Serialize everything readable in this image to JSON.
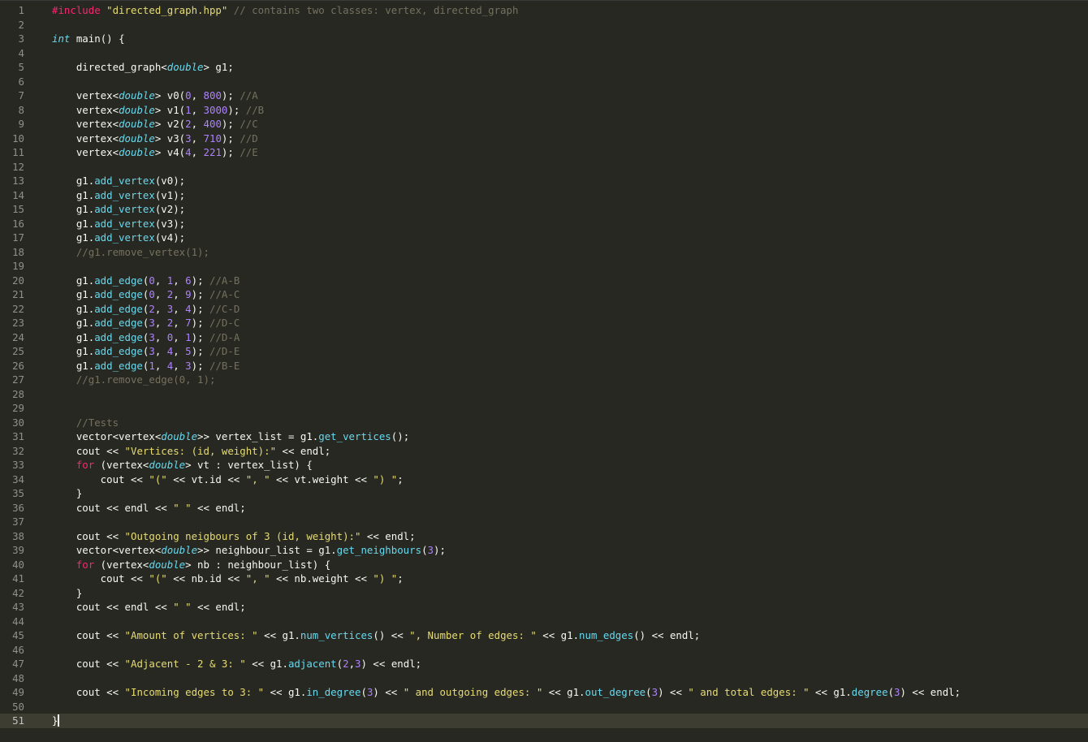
{
  "colors": {
    "background": "#272822",
    "plain": "#f8f8f2",
    "keyword": "#f92672",
    "type": "#66d9ef",
    "string": "#e6db74",
    "number": "#ae81ff",
    "comment": "#75715e",
    "function": "#66d9ef",
    "line_number": "#8f908a"
  },
  "current_line": 51,
  "lines": [
    {
      "n": "1",
      "tokens": [
        [
          "pre",
          "#include "
        ],
        [
          "str",
          "\"directed_graph.hpp\""
        ],
        [
          "cmt",
          " // contains two classes: vertex, directed_graph"
        ]
      ]
    },
    {
      "n": "2",
      "tokens": []
    },
    {
      "n": "3",
      "tokens": [
        [
          "type",
          "int"
        ],
        [
          "plain",
          " main() {"
        ]
      ]
    },
    {
      "n": "4",
      "tokens": []
    },
    {
      "n": "5",
      "tokens": [
        [
          "plain",
          "    directed_graph<"
        ],
        [
          "type",
          "double"
        ],
        [
          "plain",
          "> g1;"
        ]
      ]
    },
    {
      "n": "6",
      "tokens": []
    },
    {
      "n": "7",
      "tokens": [
        [
          "plain",
          "    vertex<"
        ],
        [
          "type",
          "double"
        ],
        [
          "plain",
          "> v0("
        ],
        [
          "num",
          "0"
        ],
        [
          "plain",
          ", "
        ],
        [
          "num",
          "800"
        ],
        [
          "plain",
          "); "
        ],
        [
          "cmt",
          "//A"
        ]
      ]
    },
    {
      "n": "8",
      "tokens": [
        [
          "plain",
          "    vertex<"
        ],
        [
          "type",
          "double"
        ],
        [
          "plain",
          "> v1("
        ],
        [
          "num",
          "1"
        ],
        [
          "plain",
          ", "
        ],
        [
          "num",
          "3000"
        ],
        [
          "plain",
          "); "
        ],
        [
          "cmt",
          "//B"
        ]
      ]
    },
    {
      "n": "9",
      "tokens": [
        [
          "plain",
          "    vertex<"
        ],
        [
          "type",
          "double"
        ],
        [
          "plain",
          "> v2("
        ],
        [
          "num",
          "2"
        ],
        [
          "plain",
          ", "
        ],
        [
          "num",
          "400"
        ],
        [
          "plain",
          "); "
        ],
        [
          "cmt",
          "//C"
        ]
      ]
    },
    {
      "n": "10",
      "tokens": [
        [
          "plain",
          "    vertex<"
        ],
        [
          "type",
          "double"
        ],
        [
          "plain",
          "> v3("
        ],
        [
          "num",
          "3"
        ],
        [
          "plain",
          ", "
        ],
        [
          "num",
          "710"
        ],
        [
          "plain",
          "); "
        ],
        [
          "cmt",
          "//D"
        ]
      ]
    },
    {
      "n": "11",
      "tokens": [
        [
          "plain",
          "    vertex<"
        ],
        [
          "type",
          "double"
        ],
        [
          "plain",
          "> v4("
        ],
        [
          "num",
          "4"
        ],
        [
          "plain",
          ", "
        ],
        [
          "num",
          "221"
        ],
        [
          "plain",
          "); "
        ],
        [
          "cmt",
          "//E"
        ]
      ]
    },
    {
      "n": "12",
      "tokens": []
    },
    {
      "n": "13",
      "tokens": [
        [
          "plain",
          "    g1."
        ],
        [
          "fn",
          "add_vertex"
        ],
        [
          "plain",
          "(v0);"
        ]
      ]
    },
    {
      "n": "14",
      "tokens": [
        [
          "plain",
          "    g1."
        ],
        [
          "fn",
          "add_vertex"
        ],
        [
          "plain",
          "(v1);"
        ]
      ]
    },
    {
      "n": "15",
      "tokens": [
        [
          "plain",
          "    g1."
        ],
        [
          "fn",
          "add_vertex"
        ],
        [
          "plain",
          "(v2);"
        ]
      ]
    },
    {
      "n": "16",
      "tokens": [
        [
          "plain",
          "    g1."
        ],
        [
          "fn",
          "add_vertex"
        ],
        [
          "plain",
          "(v3);"
        ]
      ]
    },
    {
      "n": "17",
      "tokens": [
        [
          "plain",
          "    g1."
        ],
        [
          "fn",
          "add_vertex"
        ],
        [
          "plain",
          "(v4);"
        ]
      ]
    },
    {
      "n": "18",
      "tokens": [
        [
          "cmt",
          "    //g1.remove_vertex(1);"
        ]
      ]
    },
    {
      "n": "19",
      "tokens": []
    },
    {
      "n": "20",
      "tokens": [
        [
          "plain",
          "    g1."
        ],
        [
          "fn",
          "add_edge"
        ],
        [
          "plain",
          "("
        ],
        [
          "num",
          "0"
        ],
        [
          "plain",
          ", "
        ],
        [
          "num",
          "1"
        ],
        [
          "plain",
          ", "
        ],
        [
          "num",
          "6"
        ],
        [
          "plain",
          "); "
        ],
        [
          "cmt",
          "//A-B"
        ]
      ]
    },
    {
      "n": "21",
      "tokens": [
        [
          "plain",
          "    g1."
        ],
        [
          "fn",
          "add_edge"
        ],
        [
          "plain",
          "("
        ],
        [
          "num",
          "0"
        ],
        [
          "plain",
          ", "
        ],
        [
          "num",
          "2"
        ],
        [
          "plain",
          ", "
        ],
        [
          "num",
          "9"
        ],
        [
          "plain",
          "); "
        ],
        [
          "cmt",
          "//A-C"
        ]
      ]
    },
    {
      "n": "22",
      "tokens": [
        [
          "plain",
          "    g1."
        ],
        [
          "fn",
          "add_edge"
        ],
        [
          "plain",
          "("
        ],
        [
          "num",
          "2"
        ],
        [
          "plain",
          ", "
        ],
        [
          "num",
          "3"
        ],
        [
          "plain",
          ", "
        ],
        [
          "num",
          "4"
        ],
        [
          "plain",
          "); "
        ],
        [
          "cmt",
          "//C-D"
        ]
      ]
    },
    {
      "n": "23",
      "tokens": [
        [
          "plain",
          "    g1."
        ],
        [
          "fn",
          "add_edge"
        ],
        [
          "plain",
          "("
        ],
        [
          "num",
          "3"
        ],
        [
          "plain",
          ", "
        ],
        [
          "num",
          "2"
        ],
        [
          "plain",
          ", "
        ],
        [
          "num",
          "7"
        ],
        [
          "plain",
          "); "
        ],
        [
          "cmt",
          "//D-C"
        ]
      ]
    },
    {
      "n": "24",
      "tokens": [
        [
          "plain",
          "    g1."
        ],
        [
          "fn",
          "add_edge"
        ],
        [
          "plain",
          "("
        ],
        [
          "num",
          "3"
        ],
        [
          "plain",
          ", "
        ],
        [
          "num",
          "0"
        ],
        [
          "plain",
          ", "
        ],
        [
          "num",
          "1"
        ],
        [
          "plain",
          "); "
        ],
        [
          "cmt",
          "//D-A"
        ]
      ]
    },
    {
      "n": "25",
      "tokens": [
        [
          "plain",
          "    g1."
        ],
        [
          "fn",
          "add_edge"
        ],
        [
          "plain",
          "("
        ],
        [
          "num",
          "3"
        ],
        [
          "plain",
          ", "
        ],
        [
          "num",
          "4"
        ],
        [
          "plain",
          ", "
        ],
        [
          "num",
          "5"
        ],
        [
          "plain",
          "); "
        ],
        [
          "cmt",
          "//D-E"
        ]
      ]
    },
    {
      "n": "26",
      "tokens": [
        [
          "plain",
          "    g1."
        ],
        [
          "fn",
          "add_edge"
        ],
        [
          "plain",
          "("
        ],
        [
          "num",
          "1"
        ],
        [
          "plain",
          ", "
        ],
        [
          "num",
          "4"
        ],
        [
          "plain",
          ", "
        ],
        [
          "num",
          "3"
        ],
        [
          "plain",
          "); "
        ],
        [
          "cmt",
          "//B-E"
        ]
      ]
    },
    {
      "n": "27",
      "tokens": [
        [
          "cmt",
          "    //g1.remove_edge(0, 1);"
        ]
      ]
    },
    {
      "n": "28",
      "tokens": []
    },
    {
      "n": "29",
      "tokens": []
    },
    {
      "n": "30",
      "tokens": [
        [
          "cmt",
          "    //Tests"
        ]
      ]
    },
    {
      "n": "31",
      "tokens": [
        [
          "plain",
          "    vector<vertex<"
        ],
        [
          "type",
          "double"
        ],
        [
          "plain",
          ">> vertex_list = g1."
        ],
        [
          "fn",
          "get_vertices"
        ],
        [
          "plain",
          "();"
        ]
      ]
    },
    {
      "n": "32",
      "tokens": [
        [
          "plain",
          "    cout << "
        ],
        [
          "str",
          "\"Vertices: (id, weight):\""
        ],
        [
          "plain",
          " << endl;"
        ]
      ]
    },
    {
      "n": "33",
      "tokens": [
        [
          "kw",
          "    for"
        ],
        [
          "plain",
          " (vertex<"
        ],
        [
          "type",
          "double"
        ],
        [
          "plain",
          "> vt : vertex_list) {"
        ]
      ]
    },
    {
      "n": "34",
      "tokens": [
        [
          "plain",
          "        cout << "
        ],
        [
          "str",
          "\"(\""
        ],
        [
          "plain",
          " << vt.id << "
        ],
        [
          "str",
          "\", \""
        ],
        [
          "plain",
          " << vt.weight << "
        ],
        [
          "str",
          "\") \""
        ],
        [
          "plain",
          ";"
        ]
      ]
    },
    {
      "n": "35",
      "tokens": [
        [
          "plain",
          "    }"
        ]
      ]
    },
    {
      "n": "36",
      "tokens": [
        [
          "plain",
          "    cout << endl << "
        ],
        [
          "str",
          "\" \""
        ],
        [
          "plain",
          " << endl;"
        ]
      ]
    },
    {
      "n": "37",
      "tokens": []
    },
    {
      "n": "38",
      "tokens": [
        [
          "plain",
          "    cout << "
        ],
        [
          "str",
          "\"Outgoing neigbours of 3 (id, weight):\""
        ],
        [
          "plain",
          " << endl;"
        ]
      ]
    },
    {
      "n": "39",
      "tokens": [
        [
          "plain",
          "    vector<vertex<"
        ],
        [
          "type",
          "double"
        ],
        [
          "plain",
          ">> neighbour_list = g1."
        ],
        [
          "fn",
          "get_neighbours"
        ],
        [
          "plain",
          "("
        ],
        [
          "num",
          "3"
        ],
        [
          "plain",
          ");"
        ]
      ]
    },
    {
      "n": "40",
      "tokens": [
        [
          "kw",
          "    for"
        ],
        [
          "plain",
          " (vertex<"
        ],
        [
          "type",
          "double"
        ],
        [
          "plain",
          "> nb : neighbour_list) {"
        ]
      ]
    },
    {
      "n": "41",
      "tokens": [
        [
          "plain",
          "        cout << "
        ],
        [
          "str",
          "\"(\""
        ],
        [
          "plain",
          " << nb.id << "
        ],
        [
          "str",
          "\", \""
        ],
        [
          "plain",
          " << nb.weight << "
        ],
        [
          "str",
          "\") \""
        ],
        [
          "plain",
          ";"
        ]
      ]
    },
    {
      "n": "42",
      "tokens": [
        [
          "plain",
          "    }"
        ]
      ]
    },
    {
      "n": "43",
      "tokens": [
        [
          "plain",
          "    cout << endl << "
        ],
        [
          "str",
          "\" \""
        ],
        [
          "plain",
          " << endl;"
        ]
      ]
    },
    {
      "n": "44",
      "tokens": []
    },
    {
      "n": "45",
      "tokens": [
        [
          "plain",
          "    cout << "
        ],
        [
          "str",
          "\"Amount of vertices: \""
        ],
        [
          "plain",
          " << g1."
        ],
        [
          "fn",
          "num_vertices"
        ],
        [
          "plain",
          "() << "
        ],
        [
          "str",
          "\", Number of edges: \""
        ],
        [
          "plain",
          " << g1."
        ],
        [
          "fn",
          "num_edges"
        ],
        [
          "plain",
          "() << endl;"
        ]
      ]
    },
    {
      "n": "46",
      "tokens": []
    },
    {
      "n": "47",
      "tokens": [
        [
          "plain",
          "    cout << "
        ],
        [
          "str",
          "\"Adjacent - 2 & 3: \""
        ],
        [
          "plain",
          " << g1."
        ],
        [
          "fn",
          "adjacent"
        ],
        [
          "plain",
          "("
        ],
        [
          "num",
          "2"
        ],
        [
          "plain",
          ","
        ],
        [
          "num",
          "3"
        ],
        [
          "plain",
          ") << endl;"
        ]
      ]
    },
    {
      "n": "48",
      "tokens": []
    },
    {
      "n": "49",
      "tokens": [
        [
          "plain",
          "    cout << "
        ],
        [
          "str",
          "\"Incoming edges to 3: \""
        ],
        [
          "plain",
          " << g1."
        ],
        [
          "fn",
          "in_degree"
        ],
        [
          "plain",
          "("
        ],
        [
          "num",
          "3"
        ],
        [
          "plain",
          ") << "
        ],
        [
          "str",
          "\" and outgoing edges: \""
        ],
        [
          "plain",
          " << g1."
        ],
        [
          "fn",
          "out_degree"
        ],
        [
          "plain",
          "("
        ],
        [
          "num",
          "3"
        ],
        [
          "plain",
          ") << "
        ],
        [
          "str",
          "\" and total edges: \""
        ],
        [
          "plain",
          " << g1."
        ],
        [
          "fn",
          "degree"
        ],
        [
          "plain",
          "("
        ],
        [
          "num",
          "3"
        ],
        [
          "plain",
          ") << endl;"
        ]
      ]
    },
    {
      "n": "50",
      "tokens": []
    },
    {
      "n": "51",
      "tokens": [
        [
          "plain",
          "}"
        ]
      ]
    }
  ]
}
